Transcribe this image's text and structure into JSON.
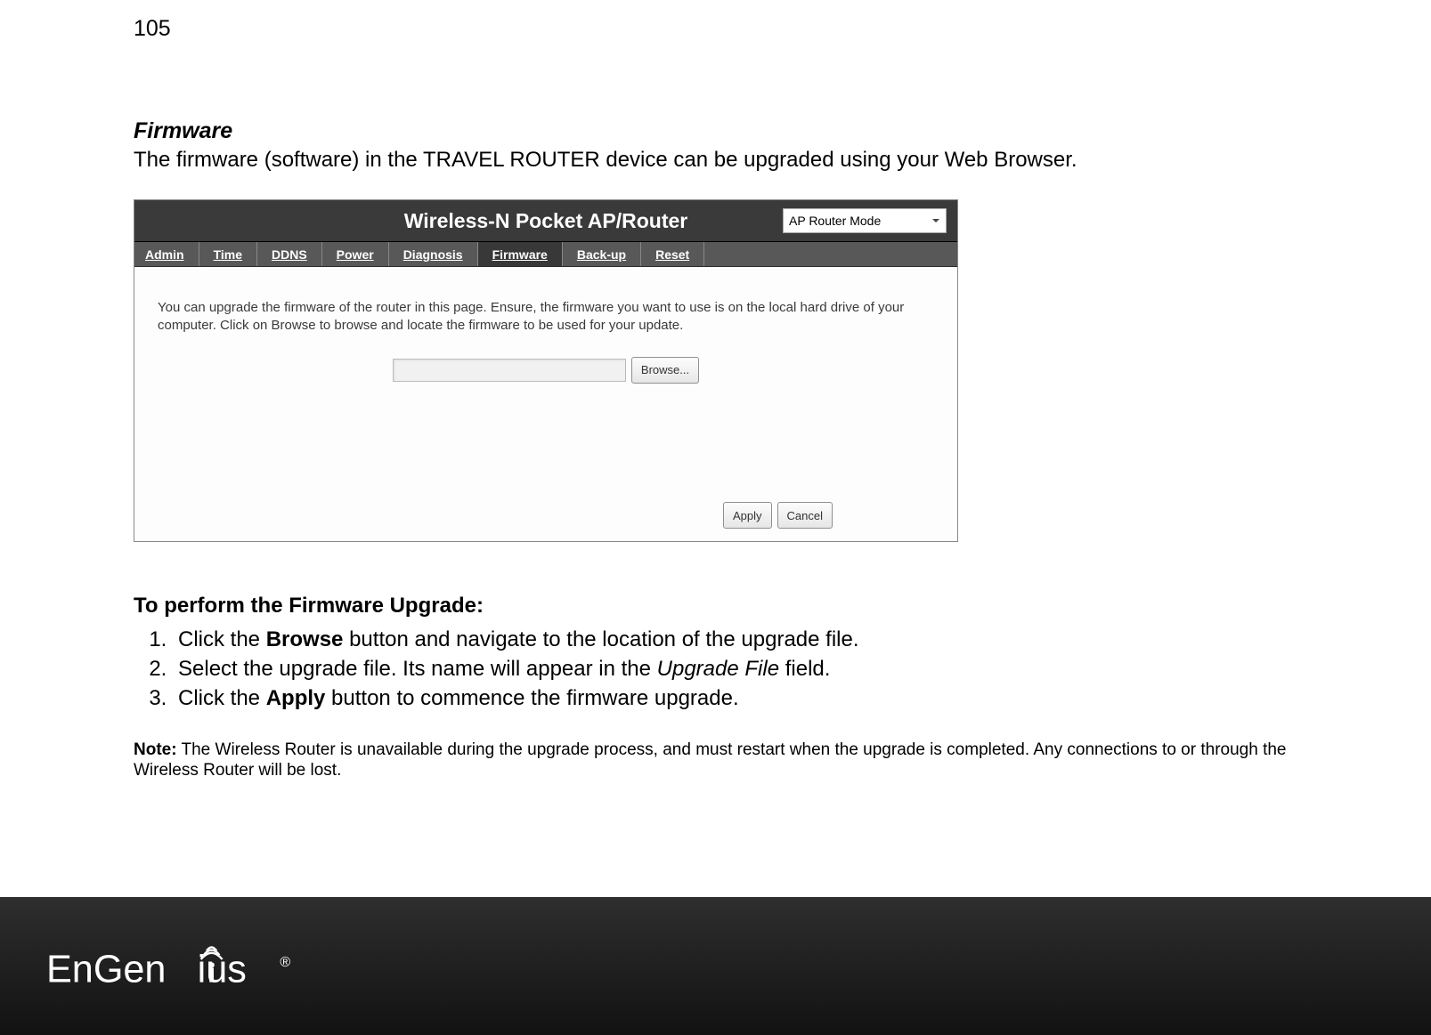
{
  "page_number": "105",
  "section": {
    "title": "Firmware",
    "intro": "The firmware (software) in the TRAVEL ROUTER device can be upgraded using your Web Browser."
  },
  "router_ui": {
    "header_title": "Wireless-N Pocket AP/Router",
    "mode": "AP Router Mode",
    "tabs": [
      "Admin",
      "Time",
      "DDNS",
      "Power",
      "Diagnosis",
      "Firmware",
      "Back-up",
      "Reset"
    ],
    "active_tab_index": 5,
    "description": "You can upgrade the firmware of the router in this page. Ensure, the firmware you want to use is on the local hard drive of your computer. Click on Browse to browse and locate the firmware to be used for your update.",
    "file_path": "",
    "browse_label": "Browse...",
    "apply_label": "Apply",
    "cancel_label": "Cancel"
  },
  "instructions": {
    "title": "To perform the Firmware Upgrade:",
    "steps": [
      {
        "pre": "Click the ",
        "bold": "Browse",
        "mid": " button and navigate to the location of the upgrade file.",
        "italic": "",
        "post": ""
      },
      {
        "pre": "Select the upgrade file. Its name will appear in the ",
        "bold": "",
        "mid": "",
        "italic": "Upgrade File",
        "post": " field."
      },
      {
        "pre": "Click the ",
        "bold": "Apply",
        "mid": " button to commence the firmware upgrade.",
        "italic": "",
        "post": ""
      }
    ]
  },
  "note": {
    "label": "Note:",
    "text": " The Wireless Router is unavailable during the upgrade process, and must restart when the upgrade is completed. Any connections to or through the Wireless Router will be lost."
  },
  "footer": {
    "brand": "EnGenius"
  }
}
